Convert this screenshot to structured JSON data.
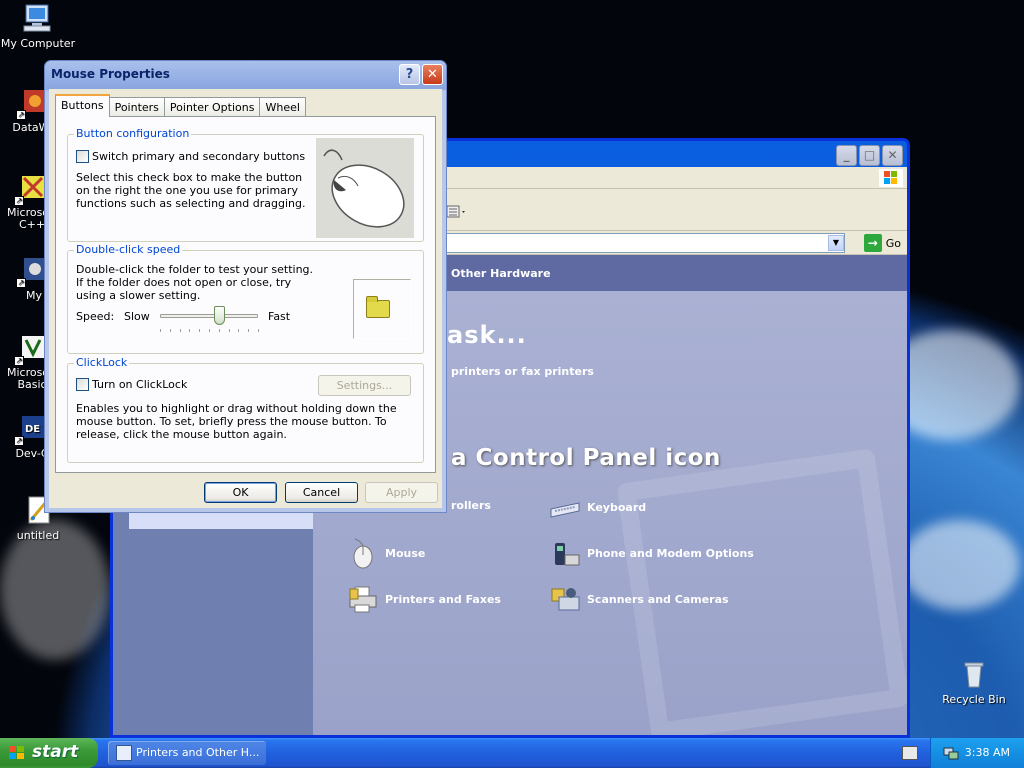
{
  "desktop": {
    "icons": [
      {
        "label": "My Computer"
      },
      {
        "label": "DataWa"
      },
      {
        "label": "Microsoft\nC++"
      },
      {
        "label": "My"
      },
      {
        "label": "Microsoft\nBasic"
      },
      {
        "label": "Dev-C"
      },
      {
        "label": "untitled"
      },
      {
        "label": "Recycle Bin"
      }
    ]
  },
  "control_panel": {
    "address_go": "Go",
    "header": "Other Hardware",
    "pick_task": "ask...",
    "task_link": "printers or fax printers",
    "pick_icon": "a Control Panel icon",
    "items": [
      {
        "label": "rollers",
        "icon": "game-controller-icon"
      },
      {
        "label": "Keyboard",
        "icon": "keyboard-icon"
      },
      {
        "label": "Mouse",
        "icon": "mouse-icon"
      },
      {
        "label": "Phone and Modem Options",
        "icon": "phone-icon"
      },
      {
        "label": "Printers and Faxes",
        "icon": "printer-icon"
      },
      {
        "label": "Scanners and Cameras",
        "icon": "scanner-icon"
      }
    ]
  },
  "dialog": {
    "title": "Mouse Properties",
    "help": "?",
    "close": "✕",
    "tabs": [
      "Buttons",
      "Pointers",
      "Pointer Options",
      "Wheel"
    ],
    "active_tab": "Buttons",
    "button_config": {
      "legend": "Button configuration",
      "checkbox_label": "Switch primary and secondary buttons",
      "checked": false,
      "description": "Select this check box to make the button on the right the one you use for primary functions such as selecting and dragging."
    },
    "double_click": {
      "legend": "Double-click speed",
      "description": "Double-click the folder to test your setting. If the folder does not open or close, try using a slower setting.",
      "speed_label": "Speed:",
      "slow": "Slow",
      "fast": "Fast",
      "level": 0.6
    },
    "clicklock": {
      "legend": "ClickLock",
      "checkbox_label": "Turn on ClickLock",
      "checked": false,
      "settings_button": "Settings...",
      "description": "Enables you to highlight or drag without holding down the mouse button. To set, briefly press the mouse button. To release, click the mouse button again."
    },
    "buttons": {
      "ok": "OK",
      "cancel": "Cancel",
      "apply": "Apply"
    }
  },
  "taskbar": {
    "start": "start",
    "task": "Printers and Other H...",
    "clock": "3:38 AM"
  },
  "colors": {
    "xp_blue": "#0a5fe0",
    "start_green": "#3c9a38",
    "groupbox_legend": "#0046d5"
  }
}
